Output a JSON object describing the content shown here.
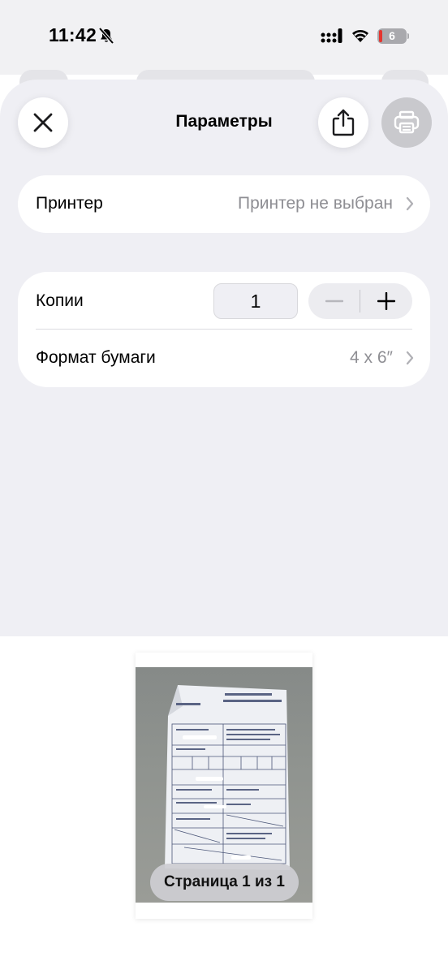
{
  "status_bar": {
    "time": "11:42",
    "battery": "6"
  },
  "header": {
    "title": "Параметры"
  },
  "printer": {
    "label": "Принтер",
    "value": "Принтер не выбран"
  },
  "copies": {
    "label": "Копии",
    "value": "1"
  },
  "paper": {
    "label": "Формат бумаги",
    "value": "4 x 6″"
  },
  "preview": {
    "page_label": "Страница 1 из 1"
  },
  "icons": {
    "close": "close-icon",
    "share": "share-icon",
    "print": "printer-icon",
    "chevron": "chevron-right-icon",
    "minus": "minus-icon",
    "plus": "plus-icon"
  },
  "colors": {
    "sheet_background": "#efeff4",
    "card_background": "#ffffff",
    "secondary_text": "#8e8e93",
    "battery_low": "#e5352f"
  }
}
